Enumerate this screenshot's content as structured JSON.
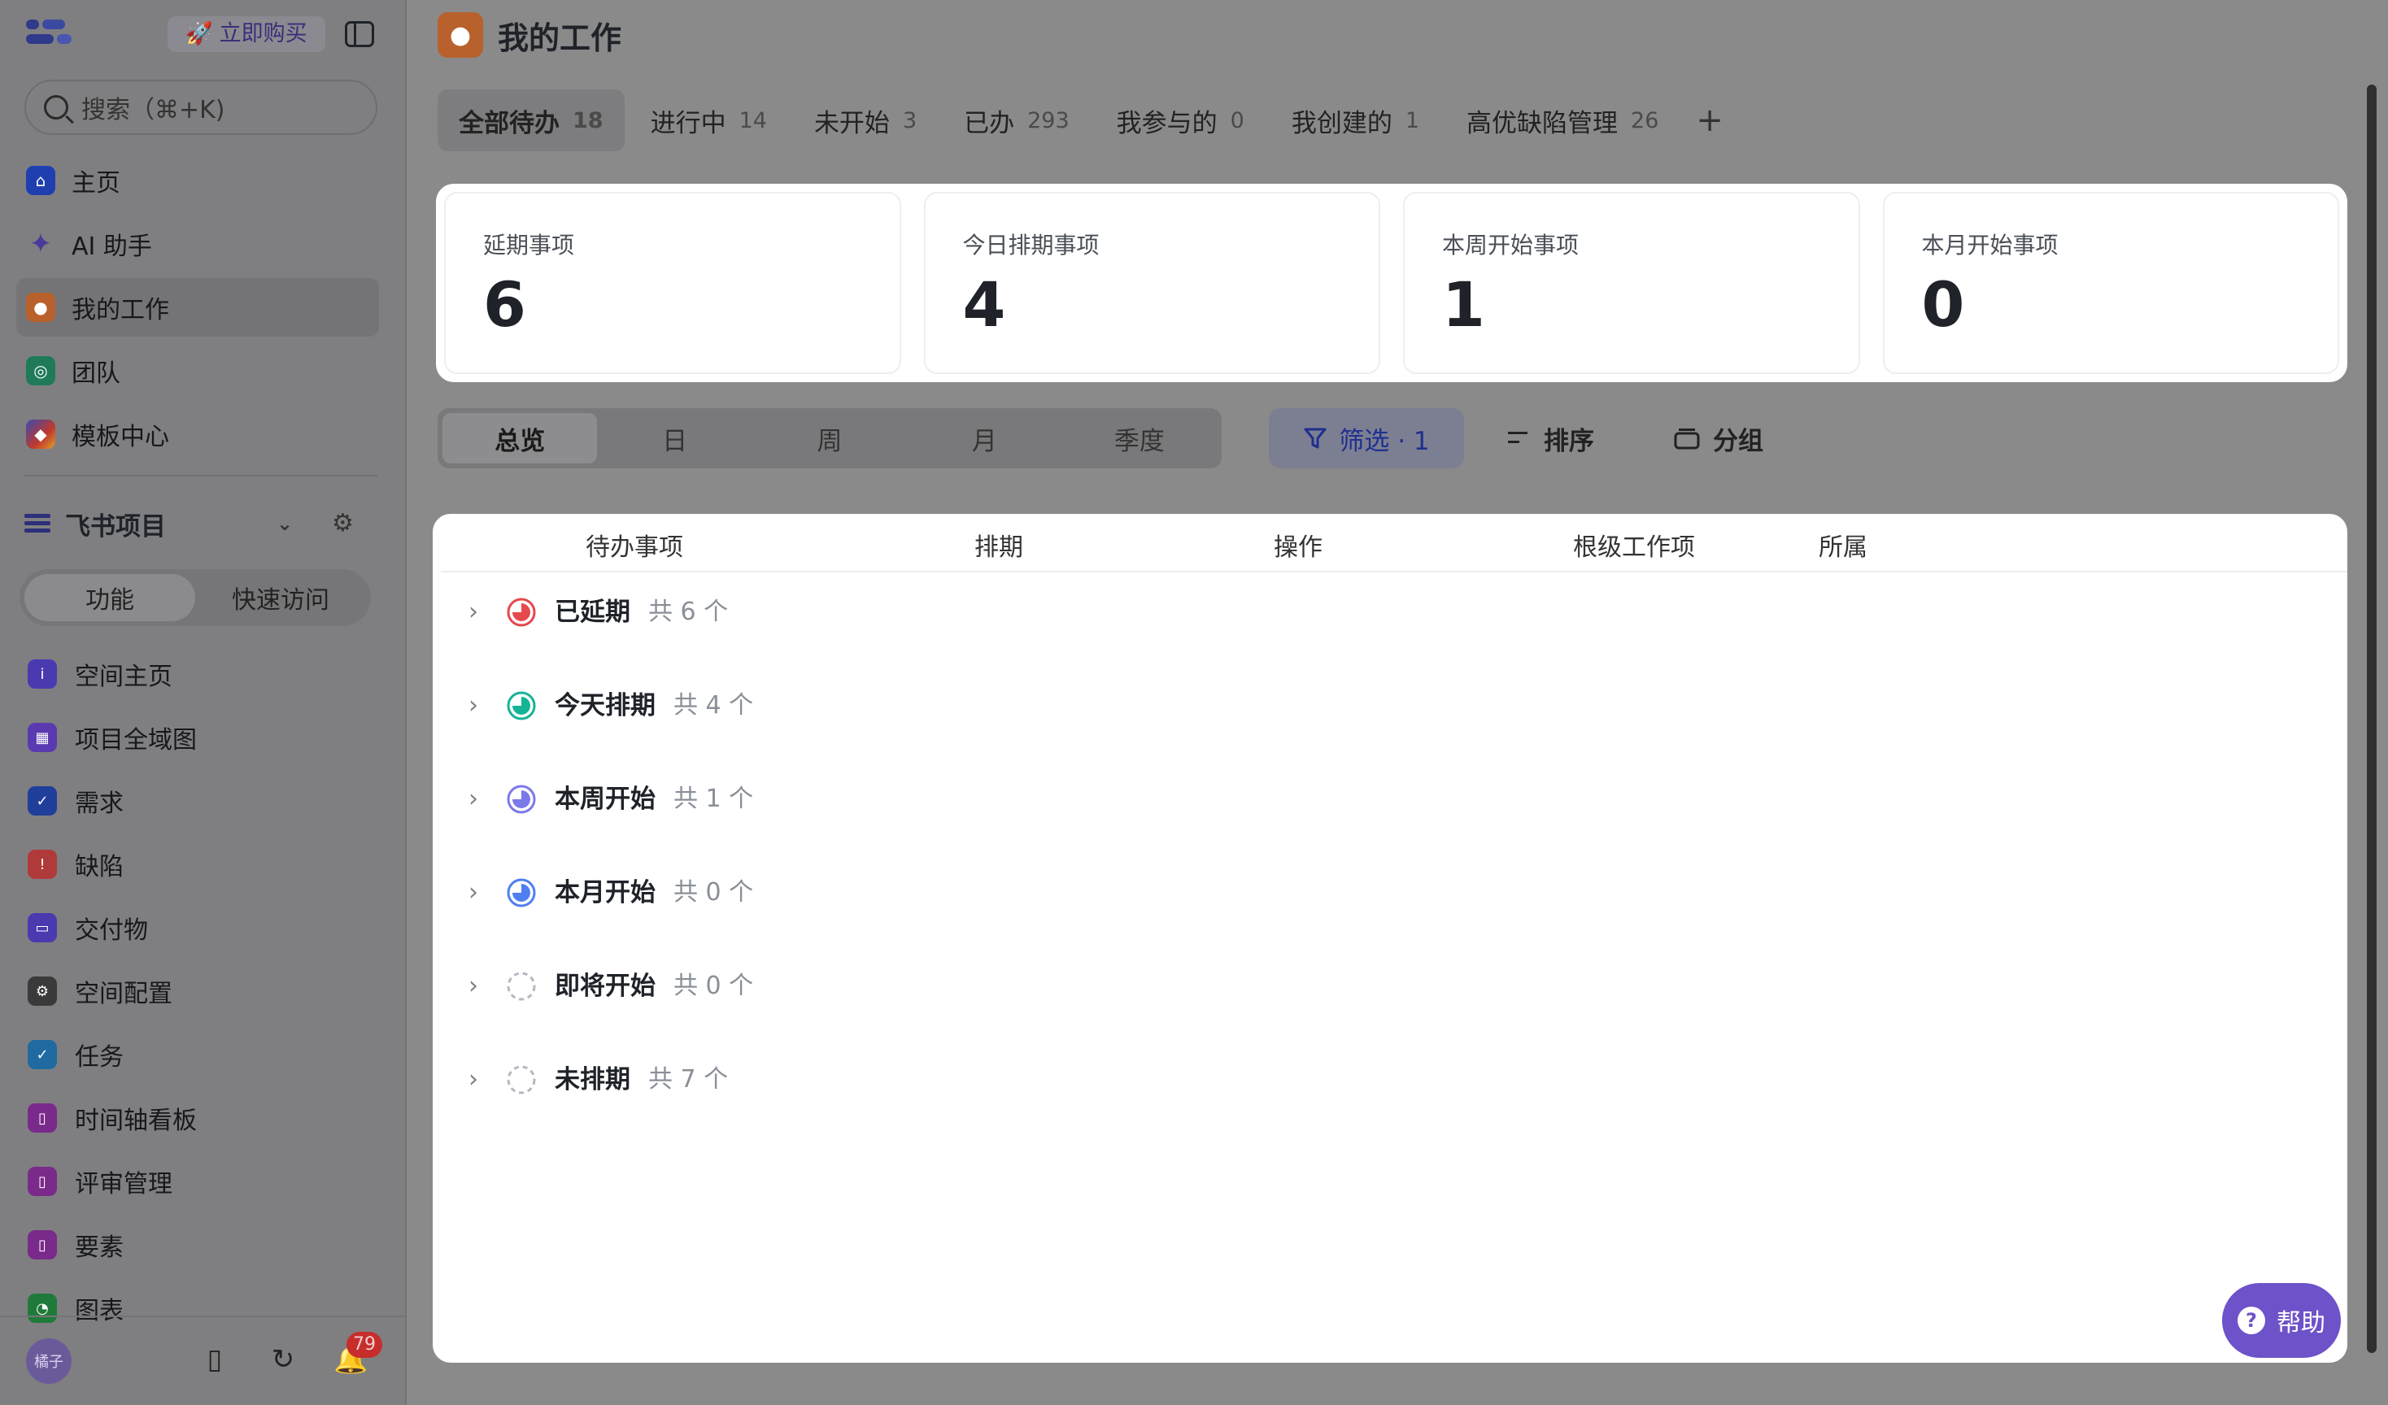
{
  "sidebar": {
    "buy_label": "立即购买",
    "search_placeholder": "搜索（⌘+K)",
    "nav": [
      {
        "label": "主页",
        "icon": "home-icon",
        "color": "#1f3fb0"
      },
      {
        "label": "AI 助手",
        "icon": "sparkle-icon",
        "color": "#4a3a9a"
      },
      {
        "label": "我的工作",
        "icon": "person-icon",
        "color": "#b8612c"
      },
      {
        "label": "团队",
        "icon": "team-icon",
        "color": "#1f7a5a"
      },
      {
        "label": "模板中心",
        "icon": "template-icon",
        "color": "#8a3a8a"
      }
    ],
    "project": {
      "label": "飞书项目"
    },
    "segments": [
      "功能",
      "快速访问"
    ],
    "sub_nav": [
      {
        "label": "空间主页",
        "icon": "info-icon",
        "color": "#4a3ab0"
      },
      {
        "label": "项目全域图",
        "icon": "grid-icon",
        "color": "#5a3ab0"
      },
      {
        "label": "需求",
        "icon": "check-icon",
        "color": "#1f3f9a"
      },
      {
        "label": "缺陷",
        "icon": "alert-icon",
        "color": "#b03a3a"
      },
      {
        "label": "交付物",
        "icon": "folder-icon",
        "color": "#4a3ab0"
      },
      {
        "label": "空间配置",
        "icon": "gear-icon",
        "color": "#3a3a3a"
      },
      {
        "label": "任务",
        "icon": "task-icon",
        "color": "#1f6aa0"
      },
      {
        "label": "时间轴看板",
        "icon": "bookmark-icon",
        "color": "#7a2a8a"
      },
      {
        "label": "评审管理",
        "icon": "bookmark-icon",
        "color": "#7a2a8a"
      },
      {
        "label": "要素",
        "icon": "bookmark-icon",
        "color": "#7a2a8a"
      },
      {
        "label": "图表",
        "icon": "chart-icon",
        "color": "#1f7a3a"
      }
    ],
    "avatar_text": "橘子",
    "notification_count": "79"
  },
  "page": {
    "title": "我的工作",
    "tabs": [
      {
        "label": "全部待办",
        "count": "18"
      },
      {
        "label": "进行中",
        "count": "14"
      },
      {
        "label": "未开始",
        "count": "3"
      },
      {
        "label": "已办",
        "count": "293"
      },
      {
        "label": "我参与的",
        "count": "0"
      },
      {
        "label": "我创建的",
        "count": "1"
      },
      {
        "label": "高优缺陷管理",
        "count": "26"
      }
    ],
    "tab_add": "+",
    "stats": [
      {
        "label": "延期事项",
        "value": "6"
      },
      {
        "label": "今日排期事项",
        "value": "4"
      },
      {
        "label": "本周开始事项",
        "value": "1"
      },
      {
        "label": "本月开始事项",
        "value": "0"
      }
    ],
    "views": [
      "总览",
      "日",
      "周",
      "月",
      "季度"
    ],
    "filter_label": "筛选 · 1",
    "sort_label": "排序",
    "group_label": "分组",
    "columns": [
      "待办事项",
      "排期",
      "操作",
      "根级工作项",
      "所属"
    ],
    "groups": [
      {
        "name": "已延期",
        "count": "共 6 个",
        "color": "#e5484d"
      },
      {
        "name": "今天排期",
        "count": "共 4 个",
        "color": "#16b396"
      },
      {
        "name": "本周开始",
        "count": "共 1 个",
        "color": "#7b78e8"
      },
      {
        "name": "本月开始",
        "count": "共 0 个",
        "color": "#4f7ef0"
      },
      {
        "name": "即将开始",
        "count": "共 0 个",
        "color": "#b4b8bf"
      },
      {
        "name": "未排期",
        "count": "共 7 个",
        "color": "#b4b8bf"
      }
    ],
    "help_label": "帮助"
  }
}
